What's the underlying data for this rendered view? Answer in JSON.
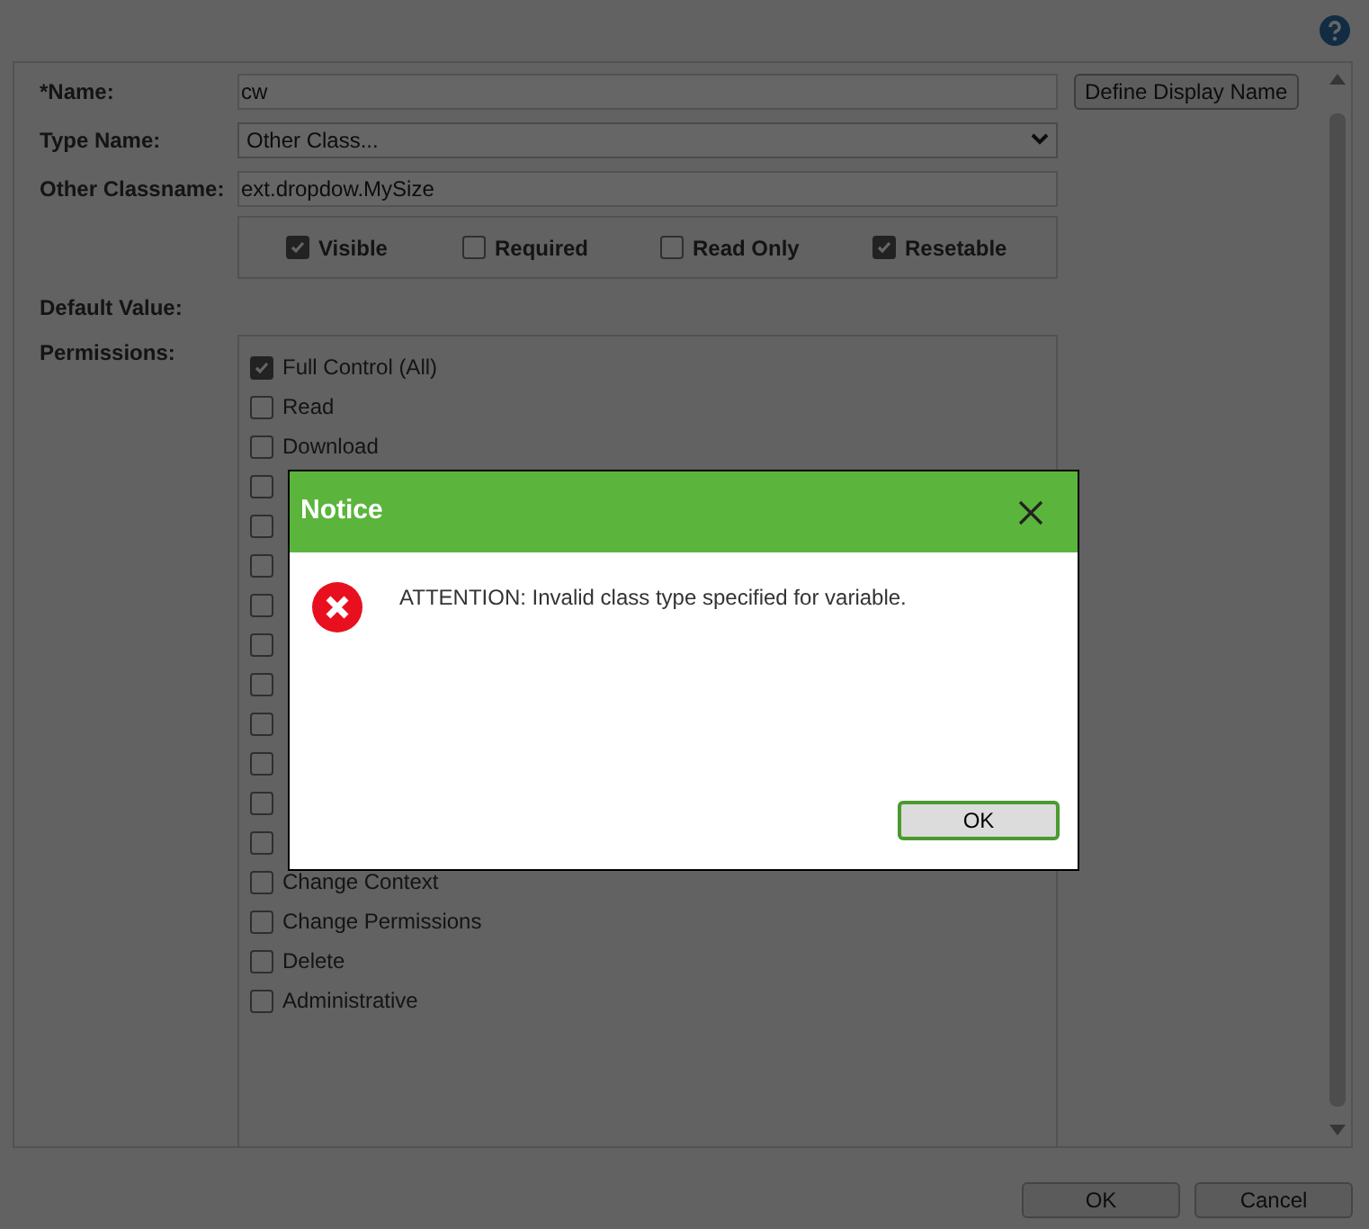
{
  "form": {
    "fields": [
      {
        "kind": "text",
        "label": "*Name:",
        "value": "cw"
      },
      {
        "kind": "select",
        "label": "Type Name:",
        "value": "Other Class..."
      },
      {
        "kind": "text",
        "label": "Other Classname:",
        "value": "ext.dropdow.MySize"
      }
    ],
    "define_button": "Define Display Name",
    "flags": [
      {
        "label": "Visible",
        "checked": true
      },
      {
        "label": "Required",
        "checked": false
      },
      {
        "label": "Read Only",
        "checked": false
      },
      {
        "label": "Resetable",
        "checked": true
      }
    ],
    "default_value_label": "Default Value:",
    "permissions_label": "Permissions:",
    "permissions": [
      {
        "label": "Full Control (All)",
        "checked": true
      },
      {
        "label": "Read",
        "checked": false
      },
      {
        "label": "Download",
        "checked": false
      },
      {
        "checked": false
      },
      {
        "checked": false
      },
      {
        "checked": false
      },
      {
        "checked": false
      },
      {
        "checked": false
      },
      {
        "checked": false
      },
      {
        "checked": false
      },
      {
        "checked": false
      },
      {
        "checked": false
      },
      {
        "checked": false
      },
      {
        "label": "Change Context",
        "checked": false
      },
      {
        "label": "Change Permissions",
        "checked": false
      },
      {
        "label": "Delete",
        "checked": false
      },
      {
        "label": "Administrative",
        "checked": false
      }
    ]
  },
  "buttons": [
    "OK",
    "Cancel"
  ],
  "dialog": {
    "title": "Notice",
    "message": "ATTENTION: Invalid class type specified for variable.",
    "button": "OK"
  }
}
